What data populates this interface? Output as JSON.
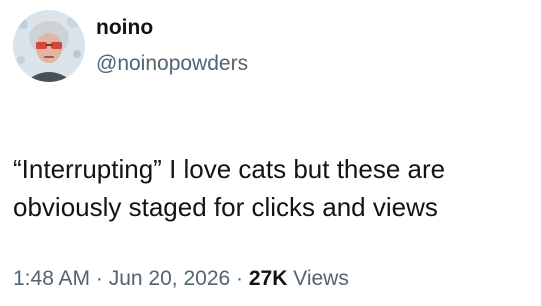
{
  "author": {
    "name": "noino",
    "handle": "@noinopowders"
  },
  "tweet": {
    "text": "“Interrupting” I love cats but these are\nobviously staged for clicks and views"
  },
  "meta": {
    "time": "1:48 AM",
    "separator": " · ",
    "date": "Jun 20, 2026",
    "views_count": "27K",
    "views_label": " Views"
  }
}
